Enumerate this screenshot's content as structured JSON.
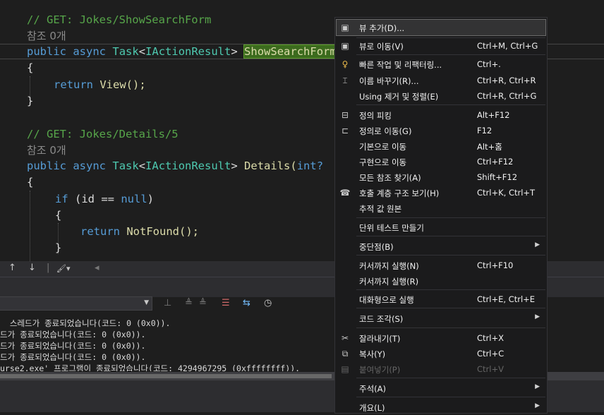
{
  "editor": {
    "lines": {
      "l1_comment": "// GET: Jokes/ShowSearchForm",
      "l2_refs": "참조 0개",
      "l3_public": "public",
      "l3_async": "async",
      "l3_task": "Task",
      "l3_lt": "<",
      "l3_iface": "IActionResult",
      "l3_gt": ">",
      "l3_method": "ShowSearchForm",
      "l4_open": "{",
      "l5_return": "return",
      "l5_call": "View();",
      "l6_close": "}",
      "l8_comment": "// GET: Jokes/Details/5",
      "l9_refs": "참조 0개",
      "l10_public": "public",
      "l10_async": "async",
      "l10_task": "Task",
      "l10_lt": "<",
      "l10_iface": "IActionResult",
      "l10_gt": ">",
      "l10_method": "Details(",
      "l10_int": "int?",
      "l11_open": "{",
      "l12_if": "if",
      "l12_cond": "(id == ",
      "l12_null": "null",
      "l12_end": ")",
      "l13_open": "{",
      "l14_return": "return",
      "l14_call": "NotFound();",
      "l15_close": "}"
    }
  },
  "edstrip": {
    "up": "↑",
    "down": "↓",
    "sep": "|",
    "brush": "🖌▾",
    "left": "◂"
  },
  "output": {
    "line0": "  스레드가 종료되었습니다(코드: 0 (0x0)).",
    "line1": "드가 종료되었습니다(코드: 0 (0x0)).",
    "line2": "드가 종료되었습니다(코드: 0 (0x0)).",
    "line3": "드가 종료되었습니다(코드: 0 (0x0)).",
    "line4": "urse2.exe' 프로그램이 종료되었습니다(코드: 4294967295 (0xffffffff))."
  },
  "menu": {
    "add_view": {
      "label": "뷰 추가(D)...",
      "icon": "page-icon"
    },
    "go_to_view": {
      "label": "뷰로 이동(V)",
      "shortcut": "Ctrl+M, Ctrl+G",
      "icon": "page-icon"
    },
    "quick_actions": {
      "label": "빠른 작업 및 리팩터링...",
      "shortcut": "Ctrl+.",
      "icon": "lightbulb-icon"
    },
    "rename": {
      "label": "이름 바꾸기(R)...",
      "shortcut": "Ctrl+R, Ctrl+R",
      "icon": "rename-icon"
    },
    "remove_sort_usings": {
      "label": "Using 제거 및 정렬(E)",
      "shortcut": "Ctrl+R, Ctrl+G"
    },
    "peek_definition": {
      "label": "정의 피킹",
      "shortcut": "Alt+F12",
      "icon": "peek-icon"
    },
    "go_to_definition": {
      "label": "정의로 이동(G)",
      "shortcut": "F12",
      "icon": "goto-definition-icon"
    },
    "go_to_base": {
      "label": "기본으로 이동",
      "shortcut": "Alt+홈"
    },
    "go_to_implementation": {
      "label": "구현으로 이동",
      "shortcut": "Ctrl+F12"
    },
    "find_all_references": {
      "label": "모든 참조 찾기(A)",
      "shortcut": "Shift+F12"
    },
    "call_hierarchy": {
      "label": "호출 계층 구조 보기(H)",
      "shortcut": "Ctrl+K, Ctrl+T",
      "icon": "call-hierarchy-icon"
    },
    "track_value_source": {
      "label": "추적 값 원본"
    },
    "create_unit_tests": {
      "label": "단위 테스트 만들기"
    },
    "breakpoint": {
      "label": "중단점(B)"
    },
    "run_to_cursor": {
      "label": "커서까지 실행(N)",
      "shortcut": "Ctrl+F10"
    },
    "force_run_to_cursor": {
      "label": "커서까지 실행(R)"
    },
    "execute_interactive": {
      "label": "대화형으로 실행",
      "shortcut": "Ctrl+E, Ctrl+E"
    },
    "snippet": {
      "label": "코드 조각(S)"
    },
    "cut": {
      "label": "잘라내기(T)",
      "shortcut": "Ctrl+X",
      "icon": "scissors-icon"
    },
    "copy": {
      "label": "복사(Y)",
      "shortcut": "Ctrl+C",
      "icon": "copy-icon"
    },
    "paste": {
      "label": "붙여넣기(P)",
      "shortcut": "Ctrl+V",
      "icon": "paste-icon"
    },
    "annotation": {
      "label": "주석(A)"
    },
    "outlining": {
      "label": "개요(L)"
    },
    "submenu_arrow": "▶"
  }
}
